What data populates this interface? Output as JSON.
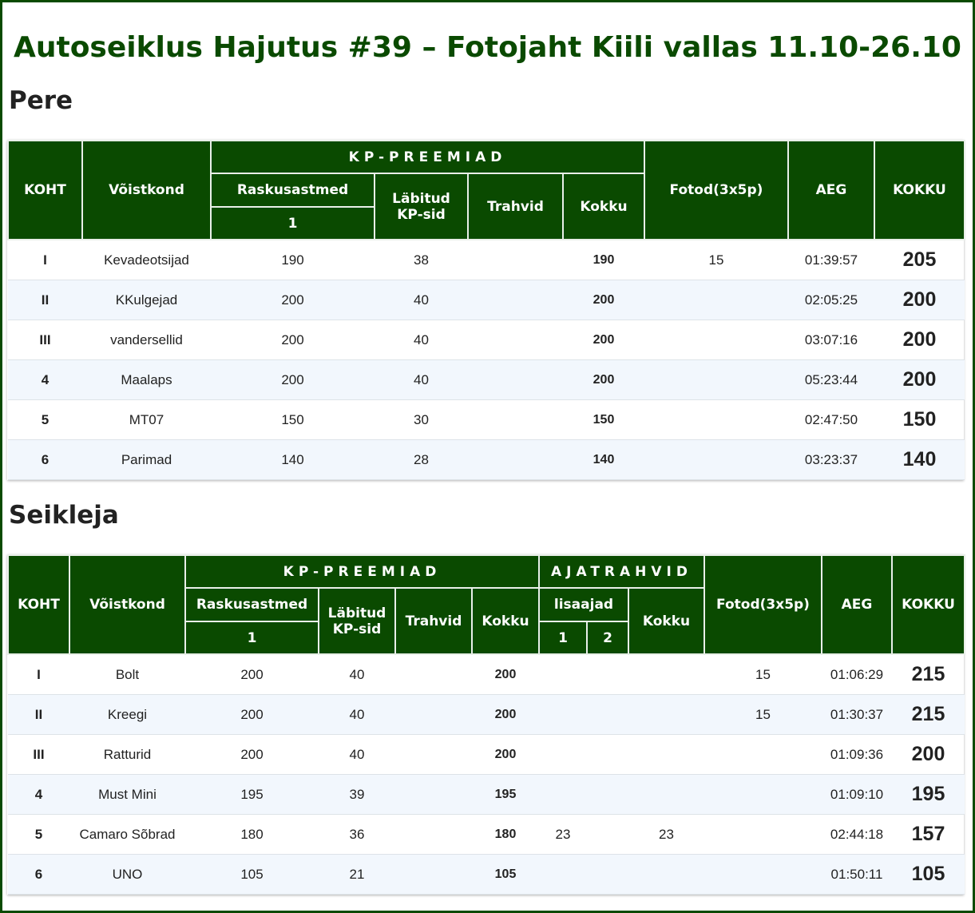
{
  "title": "Autoseiklus Hajutus #39 – Fotojaht Kiili vallas 11.10-26.10",
  "pere": {
    "heading": "Pere",
    "headers": {
      "koht": "KOHT",
      "voistkond": "Võistkond",
      "kp_preemiad": "KP-PREEMIAD",
      "raskusastmed": "Raskusastmed",
      "raskus_1": "1",
      "labitud_1": "Läbitud",
      "labitud_2": "KP-sid",
      "trahvid": "Trahvid",
      "kokku": "Kokku",
      "fotod": "Fotod(3x5p)",
      "aeg": "AEG",
      "kokku_total": "KOKKU"
    },
    "rows": [
      {
        "koht": "I",
        "team": "Kevadeotsijad",
        "r1": "190",
        "kp": "38",
        "trahvid": "",
        "kokku": "190",
        "fotod": "15",
        "aeg": "01:39:57",
        "total": "205"
      },
      {
        "koht": "II",
        "team": "KKulgejad",
        "r1": "200",
        "kp": "40",
        "trahvid": "",
        "kokku": "200",
        "fotod": "",
        "aeg": "02:05:25",
        "total": "200"
      },
      {
        "koht": "III",
        "team": "vandersellid",
        "r1": "200",
        "kp": "40",
        "trahvid": "",
        "kokku": "200",
        "fotod": "",
        "aeg": "03:07:16",
        "total": "200"
      },
      {
        "koht": "4",
        "team": "Maalaps",
        "r1": "200",
        "kp": "40",
        "trahvid": "",
        "kokku": "200",
        "fotod": "",
        "aeg": "05:23:44",
        "total": "200"
      },
      {
        "koht": "5",
        "team": "MT07",
        "r1": "150",
        "kp": "30",
        "trahvid": "",
        "kokku": "150",
        "fotod": "",
        "aeg": "02:47:50",
        "total": "150"
      },
      {
        "koht": "6",
        "team": "Parimad",
        "r1": "140",
        "kp": "28",
        "trahvid": "",
        "kokku": "140",
        "fotod": "",
        "aeg": "03:23:37",
        "total": "140"
      }
    ]
  },
  "seikleja": {
    "heading": "Seikleja",
    "headers": {
      "koht": "KOHT",
      "voistkond": "Võistkond",
      "kp_preemiad": "KP-PREEMIAD",
      "ajatrahvid": "AJATRAHVID",
      "raskusastmed": "Raskusastmed",
      "raskus_1": "1",
      "labitud_1": "Läbitud",
      "labitud_2": "KP-sid",
      "trahvid": "Trahvid",
      "kokku": "Kokku",
      "lisaajad": "lisaajad",
      "lisa_1": "1",
      "lisa_2": "2",
      "aja_kokku": "Kokku",
      "fotod": "Fotod(3x5p)",
      "aeg": "AEG",
      "kokku_total": "KOKKU"
    },
    "rows": [
      {
        "koht": "I",
        "team": "Bolt",
        "r1": "200",
        "kp": "40",
        "trahvid": "",
        "kokku": "200",
        "l1": "",
        "l2": "",
        "aja": "",
        "fotod": "15",
        "aeg": "01:06:29",
        "total": "215"
      },
      {
        "koht": "II",
        "team": "Kreegi",
        "r1": "200",
        "kp": "40",
        "trahvid": "",
        "kokku": "200",
        "l1": "",
        "l2": "",
        "aja": "",
        "fotod": "15",
        "aeg": "01:30:37",
        "total": "215"
      },
      {
        "koht": "III",
        "team": "Ratturid",
        "r1": "200",
        "kp": "40",
        "trahvid": "",
        "kokku": "200",
        "l1": "",
        "l2": "",
        "aja": "",
        "fotod": "",
        "aeg": "01:09:36",
        "total": "200"
      },
      {
        "koht": "4",
        "team": "Must Mini",
        "r1": "195",
        "kp": "39",
        "trahvid": "",
        "kokku": "195",
        "l1": "",
        "l2": "",
        "aja": "",
        "fotod": "",
        "aeg": "01:09:10",
        "total": "195"
      },
      {
        "koht": "5",
        "team": "Camaro Sõbrad",
        "r1": "180",
        "kp": "36",
        "trahvid": "",
        "kokku": "180",
        "l1": "23",
        "l2": "",
        "aja": "23",
        "fotod": "",
        "aeg": "02:44:18",
        "total": "157"
      },
      {
        "koht": "6",
        "team": "UNO",
        "r1": "105",
        "kp": "21",
        "trahvid": "",
        "kokku": "105",
        "l1": "",
        "l2": "",
        "aja": "",
        "fotod": "",
        "aeg": "01:50:11",
        "total": "105"
      }
    ]
  },
  "colors": {
    "header_green": "#0a4a00",
    "title_green": "#0a4a00",
    "row_alt": "#f2f7fd"
  }
}
